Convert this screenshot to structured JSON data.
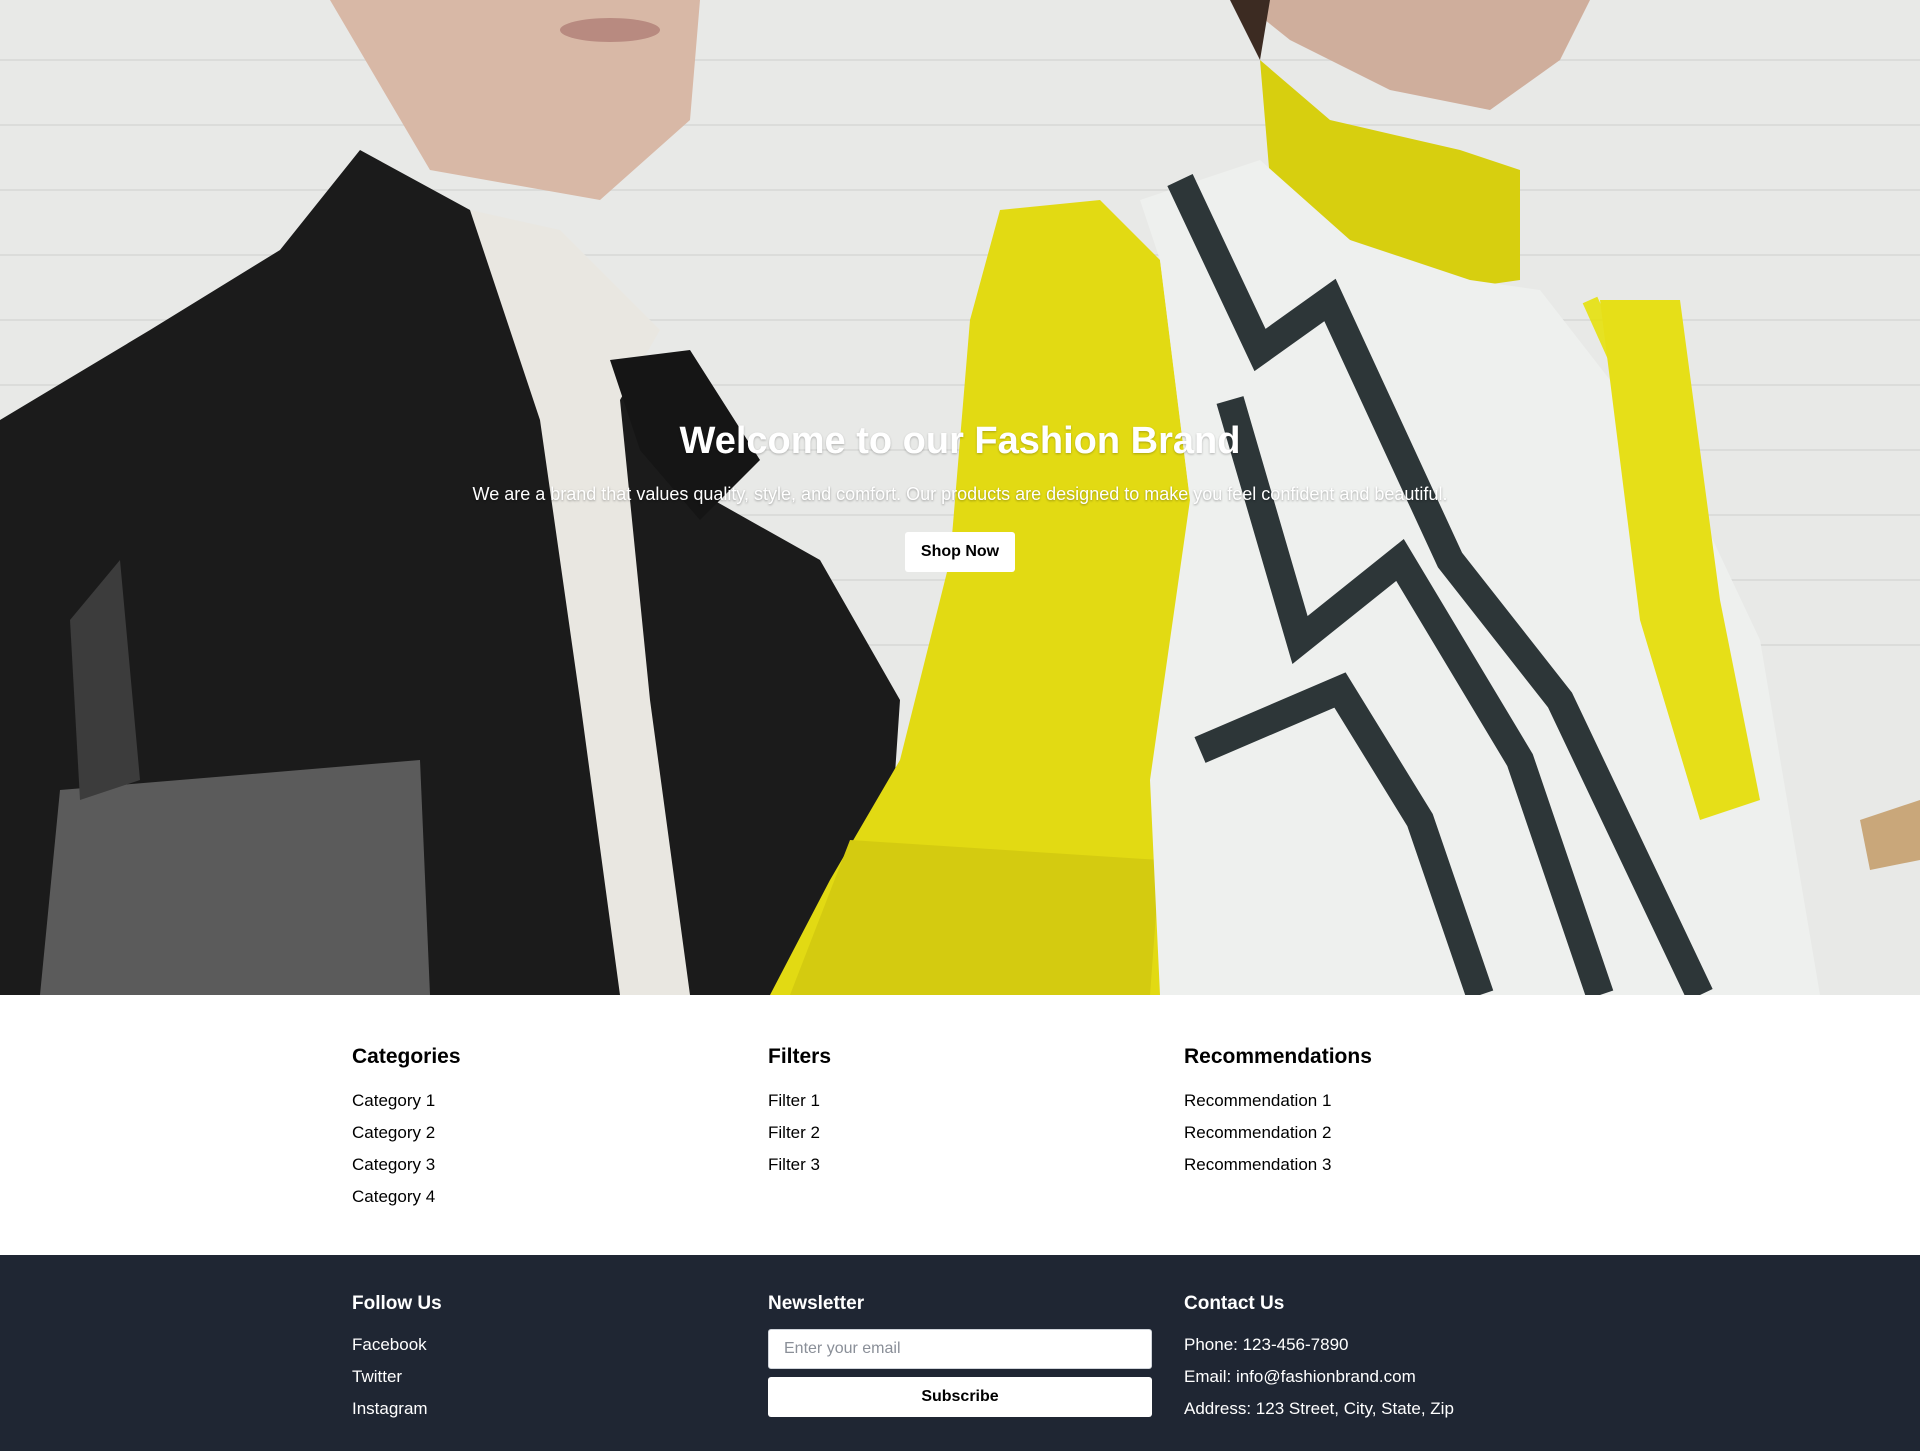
{
  "hero": {
    "title": "Welcome to our Fashion Brand",
    "subtitle": "We are a brand that values quality, style, and comfort. Our products are designed to make you feel confident and beautiful.",
    "button_label": "Shop Now"
  },
  "sections": {
    "categories": {
      "title": "Categories",
      "items": [
        "Category 1",
        "Category 2",
        "Category 3",
        "Category 4"
      ]
    },
    "filters": {
      "title": "Filters",
      "items": [
        "Filter 1",
        "Filter 2",
        "Filter 3"
      ]
    },
    "recommendations": {
      "title": "Recommendations",
      "items": [
        "Recommendation 1",
        "Recommendation 2",
        "Recommendation 3"
      ]
    }
  },
  "footer": {
    "follow": {
      "title": "Follow Us",
      "links": [
        "Facebook",
        "Twitter",
        "Instagram"
      ]
    },
    "newsletter": {
      "title": "Newsletter",
      "placeholder": "Enter your email",
      "value": "",
      "button_label": "Subscribe"
    },
    "contact": {
      "title": "Contact Us",
      "lines": [
        "Phone: 123-456-7890",
        "Email: info@fashionbrand.com",
        "Address: 123 Street, City, State, Zip"
      ]
    }
  },
  "colors": {
    "footer_bg": "#1f2633",
    "hero_accent_yellow": "#e6dc1a"
  }
}
